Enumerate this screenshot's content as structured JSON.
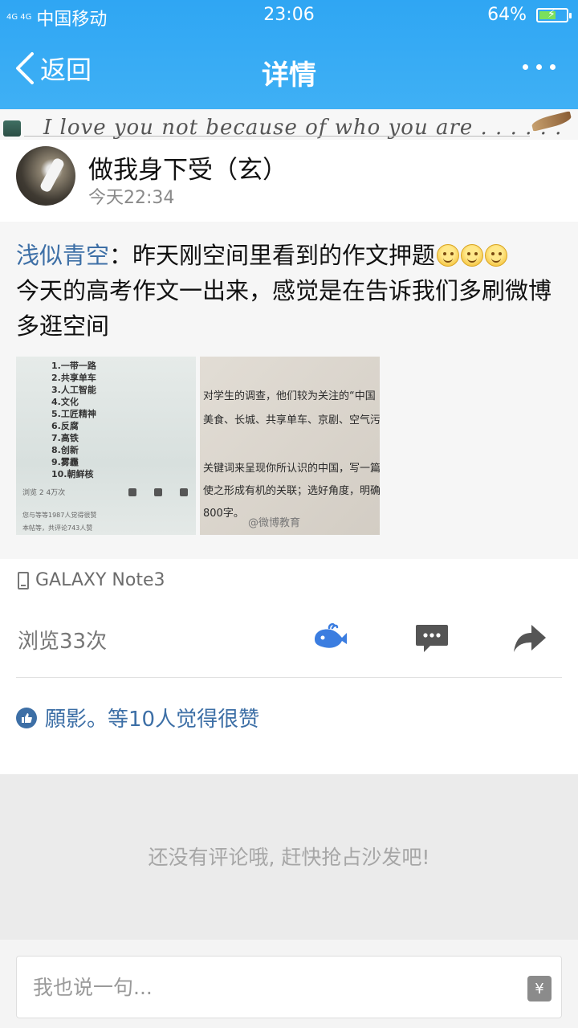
{
  "status_bar": {
    "signal": "4G 4G",
    "carrier": "中国移动",
    "time": "23:06",
    "battery": "64%",
    "battery_level": 0.64
  },
  "nav": {
    "back_label": "返回",
    "title": "详情"
  },
  "banner": {
    "text": "I love you not because of who you are . . . . . ."
  },
  "post": {
    "user_name": "做我身下受（玄）",
    "time": "今天22:34",
    "author": "浅似青空",
    "separator": "：",
    "text_line1": "昨天刚空间里看到的作文押题",
    "text_rest": "今天的高考作文一出来，感觉是在告诉我们多刷微博多逛空间",
    "image1": {
      "lines": [
        "1.一带一路",
        "2.共享单车",
        "3.人工智能",
        "4.文化",
        "5.工匠精神",
        "6.反腐",
        "7.高铁",
        "8.创新",
        "9.雾霾",
        "10.朝鲜核"
      ],
      "footer1": "浏览 2  4万次",
      "footer2": "您与等等1987人觉得很赞",
      "footer3": "本帖等，共评论743人赞"
    },
    "image2": {
      "lines": [
        "对学生的调查，他们较为关注的“中国",
        "美食、长城、共享单车、京剧、空气污",
        "关键词来呈现你所认识的中国，写一篇",
        "使之形成有机的关联；选好角度，明确",
        "800字。"
      ],
      "watermark": "@微博教育"
    },
    "device": "GALAXY Note3",
    "views": "浏览33次",
    "likes": "願影。等10人觉得很赞"
  },
  "comments": {
    "empty": "还没有评论哦, 赶快抢占沙发吧!"
  },
  "input": {
    "placeholder": "我也说一句...",
    "gift_symbol": "¥"
  }
}
